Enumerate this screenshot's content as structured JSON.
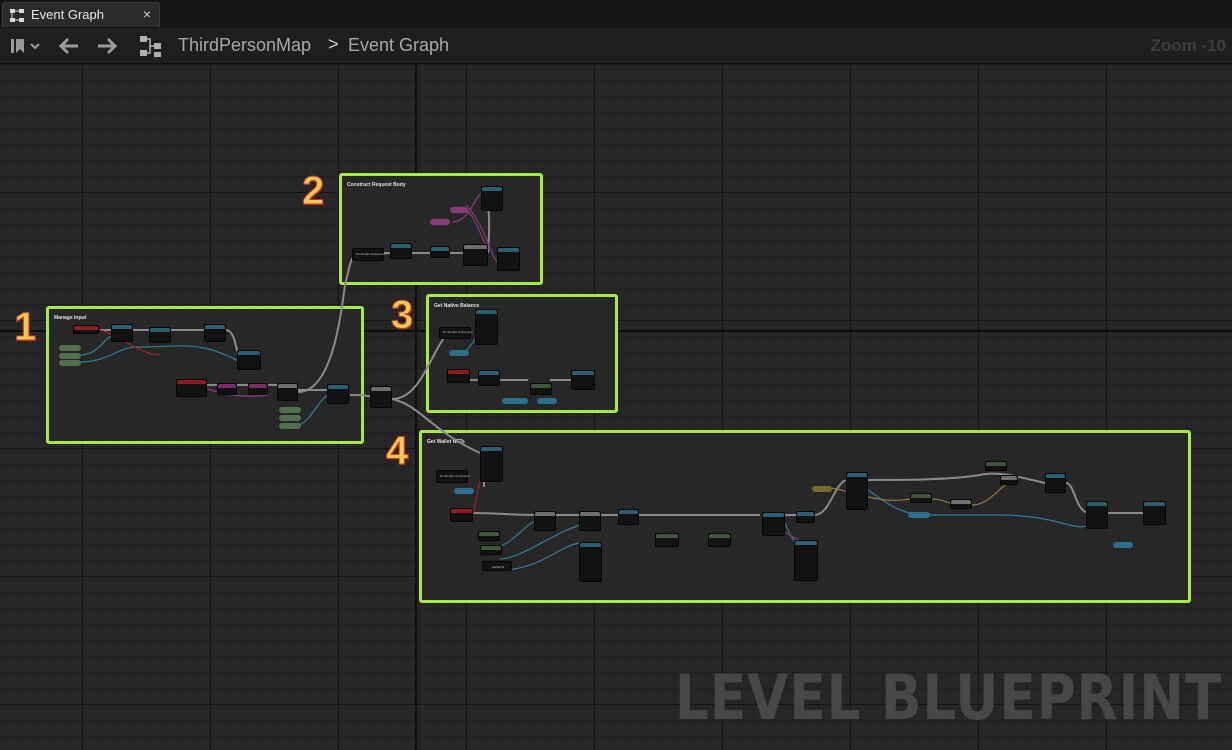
{
  "tab": {
    "label": "Event Graph",
    "close": "×"
  },
  "breadcrumb": {
    "root": "ThirdPersonMap",
    "separator": ">",
    "leaf": "Event Graph"
  },
  "zoom": "Zoom -10",
  "comments": [
    {
      "number": "1",
      "title": "Manage Input"
    },
    {
      "number": "2",
      "title": "Construct Request Body"
    },
    {
      "number": "3",
      "title": "Get Native Balance"
    },
    {
      "number": "4",
      "title": "Get Wallet NFTs"
    }
  ],
  "node_labels": {
    "subsystem": "Do Moralis Subsystem",
    "length": "LENGTH"
  },
  "watermark": "LEVEL BLUEPRINT",
  "colors": {
    "comment_border": "#a6ea4a",
    "comment_number": "#f2c94c"
  }
}
